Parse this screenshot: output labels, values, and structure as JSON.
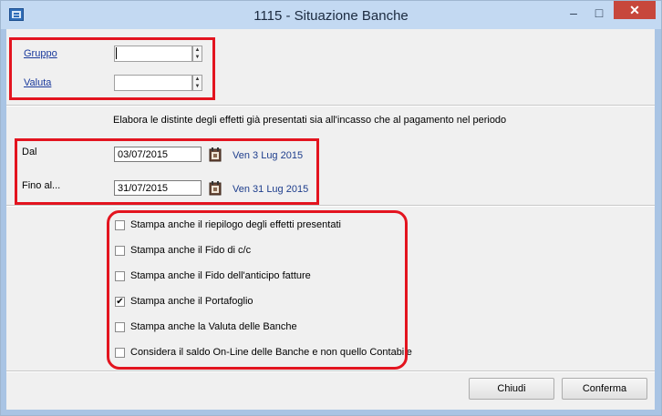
{
  "window": {
    "title": "1115 - Situazione Banche"
  },
  "titlebar_buttons": {
    "minimize": "–",
    "maximize": "□",
    "close": "✕"
  },
  "filters": {
    "gruppo_label": "Gruppo",
    "gruppo_value": "",
    "valuta_label": "Valuta",
    "valuta_value": ""
  },
  "description": "Elabora le distinte degli effetti già presentati sia all'incasso che al pagamento nel periodo",
  "period": {
    "dal_label": "Dal",
    "dal_value": "03/07/2015",
    "dal_day": "Ven 3 Lug 2015",
    "fino_label": "Fino al...",
    "fino_value": "31/07/2015",
    "fino_day": "Ven 31 Lug 2015"
  },
  "options": [
    {
      "label": "Stampa anche il riepilogo degli effetti presentati",
      "checked": false
    },
    {
      "label": "Stampa anche il Fido di c/c",
      "checked": false
    },
    {
      "label": "Stampa anche il Fido dell'anticipo fatture",
      "checked": false
    },
    {
      "label": "Stampa anche il Portafoglio",
      "checked": true
    },
    {
      "label": "Stampa anche la Valuta delle Banche",
      "checked": false
    },
    {
      "label": "Considera il saldo On-Line delle Banche e non quello Contabile",
      "checked": false
    }
  ],
  "buttons": {
    "close_label": "Chiudi",
    "confirm_label": "Conferma"
  },
  "check_mark": "✔",
  "icons": {
    "window": "app-window-icon",
    "calendar": "calendar-icon"
  },
  "colors": {
    "highlight": "#e3141f",
    "link": "#1a3a9c",
    "day_text": "#1d3d8c",
    "close": "#c7473c"
  }
}
